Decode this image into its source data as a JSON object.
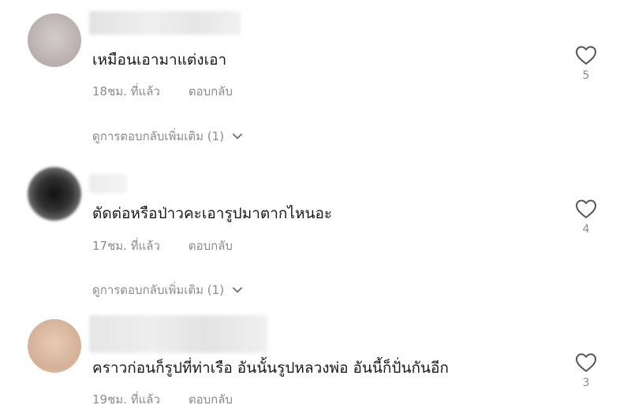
{
  "comments": [
    {
      "text": "เหมือนเอามาแต่งเอา",
      "time": "18ชม. ที่แล้ว",
      "reply": "ตอบกลับ",
      "likes": "5",
      "more_replies": "ดูการตอบกลับเพิ่มเติม (1)",
      "avatar_color": "#b8aeae"
    },
    {
      "text": "ตัดต่อหรือป่าวคะเอารูปมาตากไหนอะ",
      "time": "17ชม. ที่แล้ว",
      "reply": "ตอบกลับ",
      "likes": "4",
      "more_replies": "ดูการตอบกลับเพิ่มเติม (1)",
      "avatar_color": "#2b2b2b"
    },
    {
      "text": "คราวก่อนก็รูปที่ท่าเรือ อันนั้นรูปหลวงพ่อ อันนี้ก็ปั่นกันอีก",
      "time": "19ชม. ที่แล้ว",
      "reply": "ตอบกลับ",
      "likes": "3",
      "avatar_color": "#d9b9a0"
    }
  ],
  "icons": {
    "like": "heart-outline-icon",
    "expand": "chevron-down-icon"
  },
  "colors": {
    "text": "#161823",
    "secondary": "#8a8b91",
    "background": "#ffffff"
  }
}
